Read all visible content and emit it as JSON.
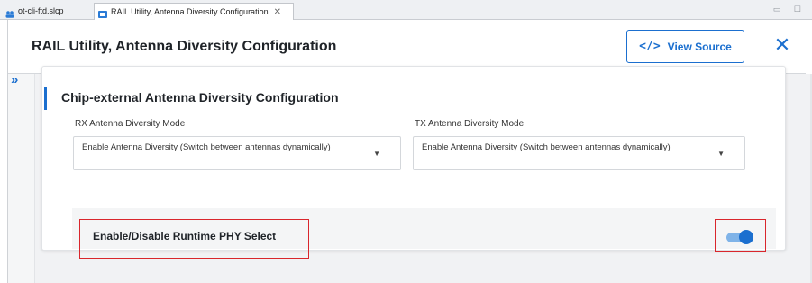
{
  "tabs": [
    {
      "label": "ot-cli-ftd.slcp",
      "active": false,
      "icon": "people-icon"
    },
    {
      "label": "RAIL Utility, Antenna Diversity Configuration",
      "active": true,
      "icon": "component-icon",
      "close_glyph": "✕"
    }
  ],
  "window_controls": "▭ ☐",
  "page": {
    "title": "RAIL Utility, Antenna Diversity Configuration",
    "view_source_icon": "</>",
    "view_source_label": "View Source",
    "close_glyph": "✕",
    "rail_toggle_glyph": "»"
  },
  "section": {
    "title": "Chip-external Antenna Diversity Configuration",
    "rx": {
      "label": "RX Antenna Diversity Mode",
      "value": "Enable Antenna Diversity (Switch between antennas dynamically)"
    },
    "tx": {
      "label": "TX Antenna Diversity Mode",
      "value": "Enable Antenna Diversity (Switch between antennas dynamically)"
    },
    "runtime_phy": {
      "label": "Enable/Disable Runtime PHY Select",
      "enabled": true
    }
  },
  "colors": {
    "accent": "#1b6fcf",
    "highlight": "#d9262c"
  }
}
